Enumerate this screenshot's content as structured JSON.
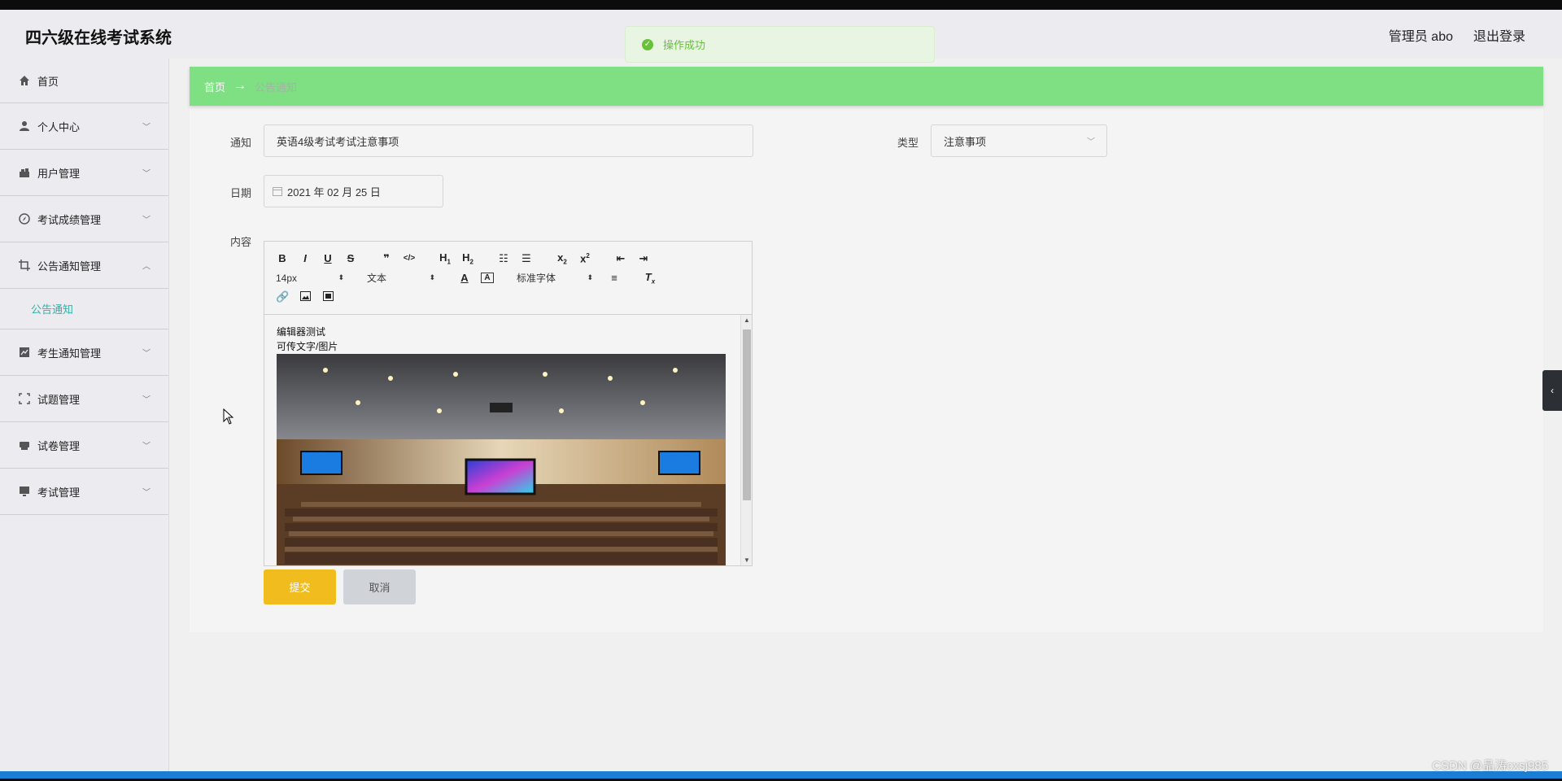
{
  "header": {
    "app_title": "四六级在线考试系统",
    "user_label": "管理员 abo",
    "logout_label": "退出登录"
  },
  "toast": {
    "message": "操作成功",
    "color": "#67c23a"
  },
  "sidebar": {
    "items": [
      {
        "label": "首页",
        "icon": "home-icon"
      },
      {
        "label": "个人中心",
        "icon": "user-icon"
      },
      {
        "label": "用户管理",
        "icon": "users-icon"
      },
      {
        "label": "考试成绩管理",
        "icon": "compass-icon"
      },
      {
        "label": "公告通知管理",
        "icon": "crop-icon",
        "expanded": true,
        "sub": [
          "公告通知"
        ]
      },
      {
        "label": "考生通知管理",
        "icon": "chart-icon"
      },
      {
        "label": "试题管理",
        "icon": "scan-icon"
      },
      {
        "label": "试卷管理",
        "icon": "printer-icon"
      },
      {
        "label": "考试管理",
        "icon": "monitor-icon"
      }
    ],
    "active_color": "#2fb0a8"
  },
  "breadcrumb": {
    "home": "首页",
    "arrow": "→",
    "current": "公告通知"
  },
  "form": {
    "notice_label": "通知",
    "notice_value": "英语4级考试考试注意事项",
    "type_label": "类型",
    "type_value": "注意事项",
    "date_label": "日期",
    "date_value": "2021 年 02 月 25 日",
    "content_label": "内容"
  },
  "editor": {
    "font_size": "14px",
    "text_style": "文本",
    "font_family": "标准字体",
    "content_line1": "编辑器测试",
    "content_line2": "可传文字/图片"
  },
  "buttons": {
    "submit": "提交",
    "cancel": "取消"
  },
  "watermark": "CSDN @晶涛cxsj985",
  "colors": {
    "breadcrumb_bg": "#7ee083",
    "submit_bg": "#f1bd1e",
    "cancel_bg": "#d0d3d8"
  }
}
